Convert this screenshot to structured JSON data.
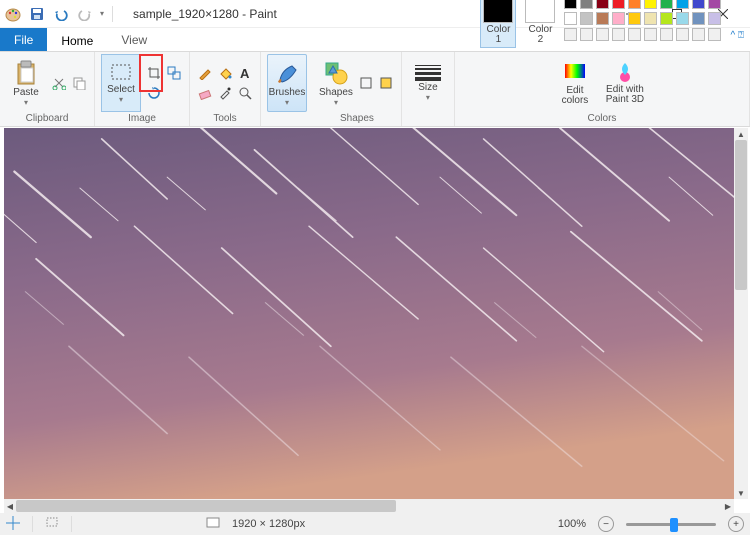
{
  "title": "sample_1920×1280 - Paint",
  "tabs": {
    "file": "File",
    "home": "Home",
    "view": "View"
  },
  "groups": {
    "clipboard": {
      "label": "Clipboard",
      "paste": "Paste"
    },
    "image": {
      "label": "Image",
      "select": "Select"
    },
    "tools": {
      "label": "Tools"
    },
    "brushes": {
      "label": "Brushes"
    },
    "shapes": {
      "label": "Shapes",
      "btn": "Shapes"
    },
    "size": {
      "label": "Size"
    },
    "colors": {
      "label": "Colors",
      "color1": "Color\n1",
      "color2": "Color\n2",
      "edit": "Edit\ncolors",
      "paint3d": "Edit with\nPaint 3D"
    }
  },
  "palette": {
    "row1": [
      "#000000",
      "#7f7f7f",
      "#880015",
      "#ed1c24",
      "#ff7f27",
      "#fff200",
      "#22b14c",
      "#00a2e8",
      "#3f48cc",
      "#a349a4"
    ],
    "row2": [
      "#ffffff",
      "#c3c3c3",
      "#b97a57",
      "#ffaec9",
      "#ffc90e",
      "#efe4b0",
      "#b5e61d",
      "#99d9ea",
      "#7092be",
      "#c8bfe7"
    ],
    "row3": [
      "#f0f0f0",
      "#f0f0f0",
      "#f0f0f0",
      "#f0f0f0",
      "#f0f0f0",
      "#f0f0f0",
      "#f0f0f0",
      "#f0f0f0",
      "#f0f0f0",
      "#f0f0f0"
    ]
  },
  "color1": "#000000",
  "color2": "#ffffff",
  "status": {
    "dimensions": "1920 × 1280px",
    "zoom": "100%"
  }
}
